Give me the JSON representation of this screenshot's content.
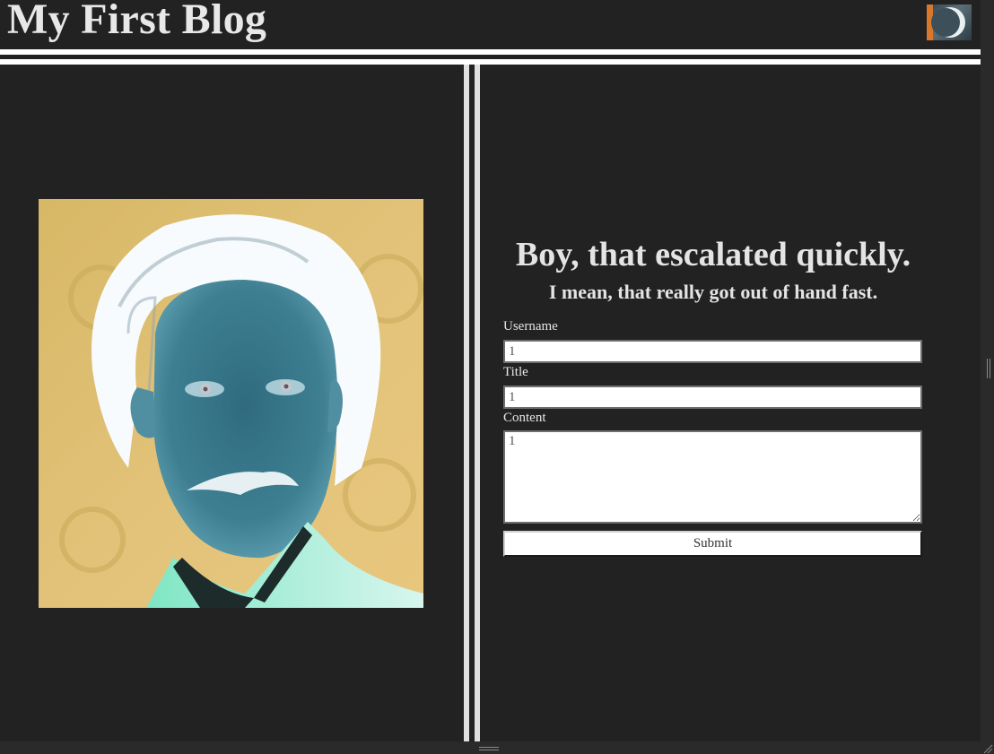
{
  "header": {
    "title": "My First Blog",
    "logo_icon": "moon-logo-icon"
  },
  "left": {
    "image_icon": "portrait-image"
  },
  "post_form": {
    "heading": "Boy, that escalated quickly.",
    "subheading": "I mean, that really got out of hand fast.",
    "username_label": "Username",
    "username_value": "1",
    "title_label": "Title",
    "title_value": "1",
    "content_label": "Content",
    "content_value": "1",
    "submit_label": "Submit"
  },
  "colors": {
    "background": "#222222",
    "rule": "#ffffff",
    "text": "#e4e4e4"
  }
}
